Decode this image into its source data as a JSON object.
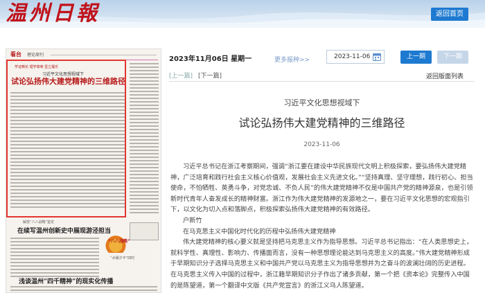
{
  "header": {
    "logo_text": "温州日報",
    "home_button": "返回首页",
    "colors": {
      "logo": "#c1121b",
      "band": "#cfe0f0",
      "accent": "#1e7ad0"
    }
  },
  "paper_thumb": {
    "masthead_name": "看台",
    "masthead_sub": "理论周刊",
    "highlight_tag": "学证精论  理学尊荣  壹立擅乐",
    "highlight_subtitle": "习近平文化思想视域下",
    "highlight_title": "试论弘扬伟大建党精神的三维路径",
    "section_label_1": "解放“八八战略”鉴定",
    "headline_1": "在续写温州创新史中展现游泾担当",
    "deco_label": "“八八战略”",
    "section_label_2": "“水桶夕平”四时",
    "headline_2": "浅谈温州“四千精神”的现实化传播"
  },
  "toolbar": {
    "date_label": "2023年11月06日 星期一",
    "more_link": "更多报种>>",
    "date_value": "2023-11-06",
    "prev_button": "上一期",
    "next_button": "下一期"
  },
  "article_nav": {
    "prev_article": "[上一篇]",
    "next_article": "[下一篇]",
    "back_to_layout": "返回版面列表"
  },
  "article": {
    "kicker": "习近平文化思想视域下",
    "title": "试论弘扬伟大建党精神的三维路径",
    "date": "2023-11-06",
    "paragraphs": [
      "习近平总书记在浙江考察期间，强调“浙江要在建设中华民族现代文明上积极探索，要弘扬伟大建党精神，广泛培育和践行社会主义核心价值观，发展社会主义先进文化。”“坚持真理、坚守理想，践行初心、担当使命，不怕牺牲、英勇斗争，对党忠诚、不负人民”的伟大建党精神不仅是中国共产党的精神源泉，也是引领新时代青年人奋发成长的精神财富。浙江作为伟大建党精神的发源地之一，要在习近平文化思想的宏观指引下，以文化为切入点和落脚点，积极探索弘扬伟大建党精神的有效路径。",
      "户新竹",
      "在马克思主义中国化时代化的历程中弘扬伟大建党精神",
      "伟大建党精神的核心要义就是坚持把马克思主义作为指导思想。习近平总书记指出：“在人类思想史上，就科学性、真理性、影响力、传播面而言，没有一种思想理论能达到马克思主义的高度。”伟大建党精神形成于早期知识分子选择马克思主义和中国共产党以马克思主义为指导思想并为之奋斗的波澜壮阔的历史进程。在马克思主义传入中国的过程中，浙江籍早期知识分子作出了诸多贡献，第一个把《资本论》完整传入中国的是陈望道，第一个翻译中文版《共产党宣言》的浙江义乌人陈望道。"
    ]
  }
}
